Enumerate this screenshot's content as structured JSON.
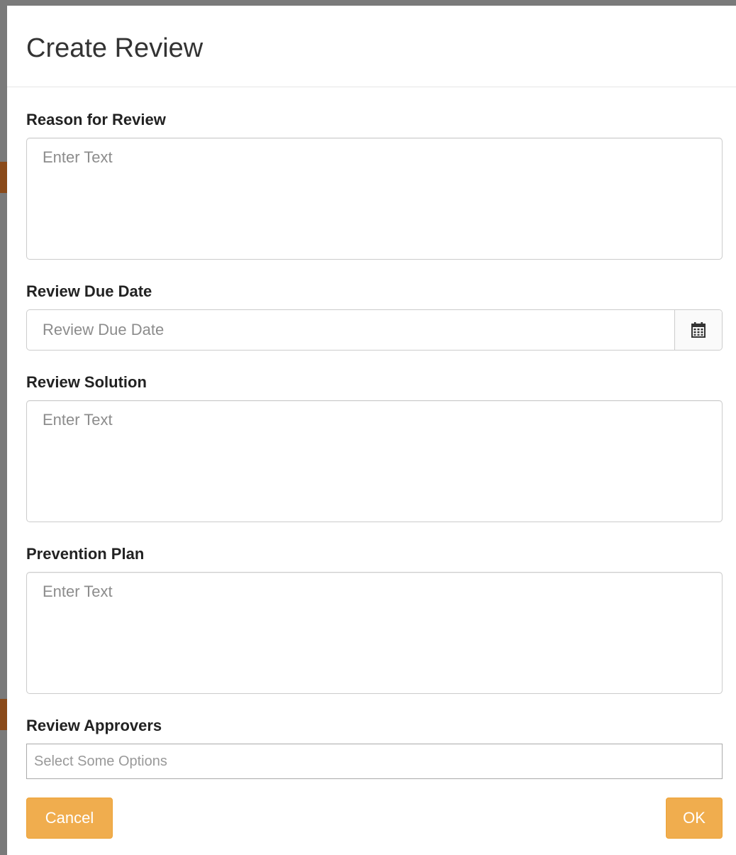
{
  "modal": {
    "title": "Create Review"
  },
  "form": {
    "reason": {
      "label": "Reason for Review",
      "placeholder": "Enter Text",
      "value": ""
    },
    "due_date": {
      "label": "Review Due Date",
      "placeholder": "Review Due Date",
      "value": "",
      "icon": "calendar-icon"
    },
    "solution": {
      "label": "Review Solution",
      "placeholder": "Enter Text",
      "value": ""
    },
    "prevention": {
      "label": "Prevention Plan",
      "placeholder": "Enter Text",
      "value": ""
    },
    "approvers": {
      "label": "Review Approvers",
      "placeholder": "Select Some Options"
    }
  },
  "buttons": {
    "cancel_label": "Cancel",
    "ok_label": "OK"
  },
  "colors": {
    "button_bg": "#f0ad4e",
    "button_border": "#eea236",
    "overlay": "#7a7a7a"
  }
}
